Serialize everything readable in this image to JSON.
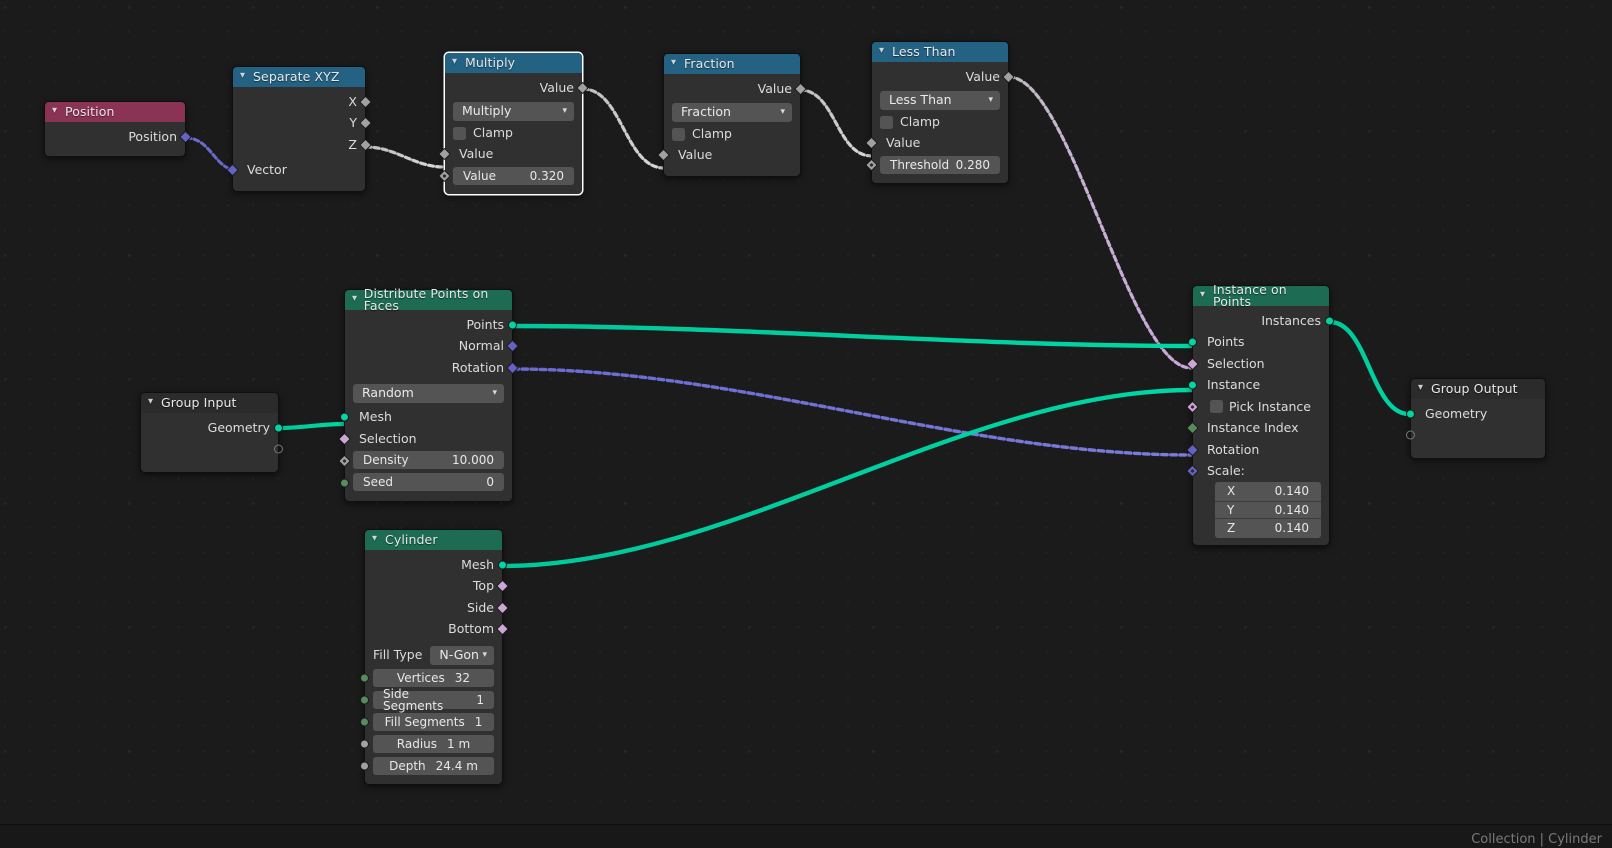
{
  "editor": {
    "status_text": "Collection | Cylinder",
    "colors": {
      "background": "#1b1b1b",
      "header_geometry": "#1c6b52",
      "header_converter": "#246283",
      "header_attribute": "#8b3355",
      "header_input": "#2b2b2b",
      "socket_geometry": "#00d6a4",
      "socket_vector": "#6363c7",
      "socket_value": "#a1a1a1",
      "socket_boolean": "#cca6d6",
      "socket_integer": "#598c5c",
      "noodle_geometry": "#00c89a",
      "noodle_vector": "#6a6ad0",
      "noodle_value": "#c5c5c5",
      "noodle_boolean": "#c9a4d4",
      "selection_outline": "#ffffff"
    }
  },
  "nodes": {
    "position": {
      "title": "Position",
      "outputs": [
        {
          "label": "Position",
          "type": "vector"
        }
      ]
    },
    "separate_xyz": {
      "title": "Separate XYZ",
      "outputs": [
        {
          "label": "X",
          "type": "value"
        },
        {
          "label": "Y",
          "type": "value"
        },
        {
          "label": "Z",
          "type": "value"
        }
      ],
      "inputs": [
        {
          "label": "Vector",
          "type": "vector"
        }
      ]
    },
    "multiply": {
      "title": "Multiply",
      "selected": true,
      "outputs": [
        {
          "label": "Value",
          "type": "value"
        }
      ],
      "operation": "Multiply",
      "clamp_label": "Clamp",
      "clamp_checked": false,
      "inputs": [
        {
          "label": "Value",
          "type": "value"
        }
      ],
      "value_field": {
        "name": "Value",
        "value": "0.320"
      }
    },
    "fraction": {
      "title": "Fraction",
      "outputs": [
        {
          "label": "Value",
          "type": "value"
        }
      ],
      "operation": "Fraction",
      "clamp_label": "Clamp",
      "clamp_checked": false,
      "inputs": [
        {
          "label": "Value",
          "type": "value"
        }
      ]
    },
    "less_than": {
      "title": "Less Than",
      "outputs": [
        {
          "label": "Value",
          "type": "value"
        }
      ],
      "operation": "Less Than",
      "clamp_label": "Clamp",
      "clamp_checked": false,
      "inputs": [
        {
          "label": "Value",
          "type": "value"
        }
      ],
      "threshold_field": {
        "name": "Threshold",
        "value": "0.280"
      }
    },
    "group_input": {
      "title": "Group Input",
      "outputs": [
        {
          "label": "Geometry",
          "type": "geometry"
        }
      ],
      "virtual_socket": true
    },
    "distribute": {
      "title": "Distribute Points on Faces",
      "outputs": [
        {
          "label": "Points",
          "type": "geometry"
        },
        {
          "label": "Normal",
          "type": "vector"
        },
        {
          "label": "Rotation",
          "type": "vector"
        }
      ],
      "method": "Random",
      "inputs": [
        {
          "label": "Mesh",
          "type": "geometry"
        },
        {
          "label": "Selection",
          "type": "boolean"
        }
      ],
      "density_field": {
        "name": "Density",
        "value": "10.000"
      },
      "seed_field": {
        "name": "Seed",
        "value": "0"
      }
    },
    "cylinder": {
      "title": "Cylinder",
      "outputs": [
        {
          "label": "Mesh",
          "type": "geometry"
        },
        {
          "label": "Top",
          "type": "boolean"
        },
        {
          "label": "Side",
          "type": "boolean"
        },
        {
          "label": "Bottom",
          "type": "boolean"
        }
      ],
      "fill_type_label": "Fill Type",
      "fill_type_value": "N-Gon",
      "fields": [
        {
          "name": "Vertices",
          "value": "32",
          "socket": "integer"
        },
        {
          "name": "Side Segments",
          "value": "1",
          "socket": "integer"
        },
        {
          "name": "Fill Segments",
          "value": "1",
          "socket": "integer"
        },
        {
          "name": "Radius",
          "value": "1 m",
          "socket": "value"
        },
        {
          "name": "Depth",
          "value": "24.4 m",
          "socket": "value"
        }
      ]
    },
    "instance_on_points": {
      "title": "Instance on Points",
      "outputs": [
        {
          "label": "Instances",
          "type": "geometry"
        }
      ],
      "inputs": [
        {
          "label": "Points",
          "type": "geometry"
        },
        {
          "label": "Selection",
          "type": "boolean"
        },
        {
          "label": "Instance",
          "type": "geometry"
        },
        {
          "label": "Pick Instance",
          "type": "boolean",
          "checkbox": true
        },
        {
          "label": "Instance Index",
          "type": "integer"
        },
        {
          "label": "Rotation",
          "type": "vector"
        },
        {
          "label": "Scale:",
          "type": "vector"
        }
      ],
      "scale": [
        {
          "axis": "X",
          "value": "0.140"
        },
        {
          "axis": "Y",
          "value": "0.140"
        },
        {
          "axis": "Z",
          "value": "0.140"
        }
      ]
    },
    "group_output": {
      "title": "Group Output",
      "inputs": [
        {
          "label": "Geometry",
          "type": "geometry"
        }
      ],
      "virtual_socket": true
    }
  }
}
